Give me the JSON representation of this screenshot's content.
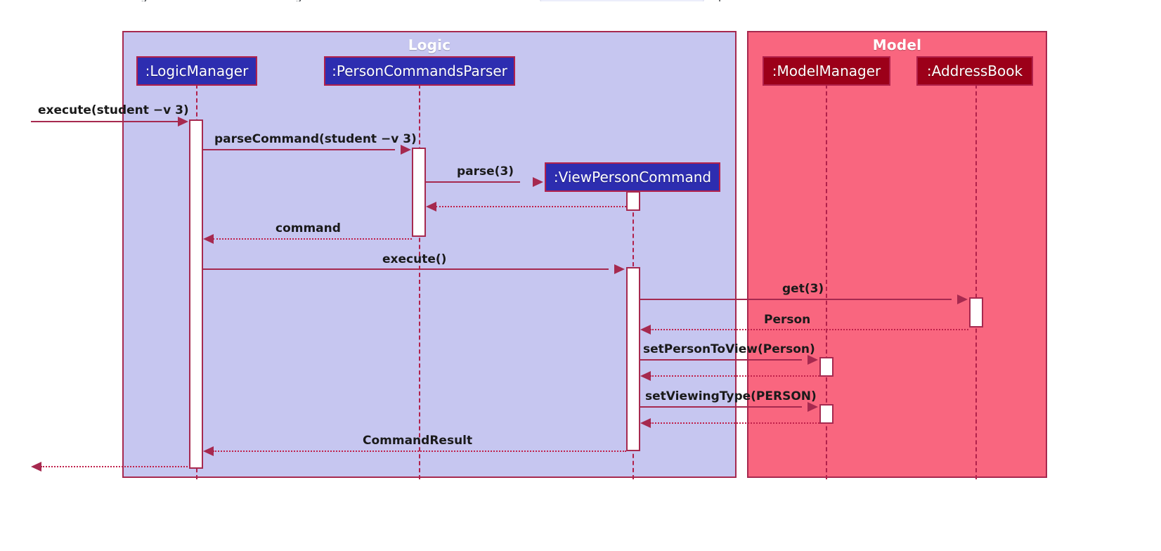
{
  "diagram": {
    "kind": "uml-sequence-diagram",
    "title_top_fragment_1": "g",
    "title_top_fragment_2": "g",
    "title_top_fragment_3": "p",
    "groups": [
      {
        "name": "Logic",
        "label": "Logic",
        "fill": "#c6c6f0",
        "border": "#a6294f"
      },
      {
        "name": "Model",
        "label": "Model",
        "fill": "#f9667f",
        "border": "#a6294f"
      }
    ],
    "participants": [
      {
        "id": "logicmanager",
        "label": ":LogicManager",
        "group": "Logic",
        "fill": "#2d2db0"
      },
      {
        "id": "personcommandsparser",
        "label": ":PersonCommandsParser",
        "group": "Logic",
        "fill": "#2d2db0"
      },
      {
        "id": "viewpersoncommand",
        "label": ":ViewPersonCommand",
        "group": "Logic",
        "fill": "#2d2db0"
      },
      {
        "id": "modelmanager",
        "label": ":ModelManager",
        "group": "Model",
        "fill": "#9c0019"
      },
      {
        "id": "addressbook",
        "label": ":AddressBook",
        "group": "Model",
        "fill": "#9c0019"
      }
    ],
    "messages": [
      {
        "seq": 1,
        "label": "execute(student −v 3)",
        "from": "actor",
        "to": "logicmanager",
        "type": "call",
        "bold": true
      },
      {
        "seq": 2,
        "label": "parseCommand(student −v 3)",
        "from": "logicmanager",
        "to": "personcommandsparser",
        "type": "call",
        "bold": true
      },
      {
        "seq": 3,
        "label": "parse(3)",
        "from": "personcommandsparser",
        "to": "viewpersoncommand",
        "type": "call",
        "bold": true
      },
      {
        "seq": 4,
        "label": "",
        "from": "viewpersoncommand",
        "to": "personcommandsparser",
        "type": "return",
        "bold": false
      },
      {
        "seq": 5,
        "label": "command",
        "from": "personcommandsparser",
        "to": "logicmanager",
        "type": "return",
        "bold": true
      },
      {
        "seq": 6,
        "label": "execute()",
        "from": "logicmanager",
        "to": "viewpersoncommand",
        "type": "call",
        "bold": true
      },
      {
        "seq": 7,
        "label": "get(3)",
        "from": "viewpersoncommand",
        "to": "addressbook",
        "type": "call",
        "bold": true
      },
      {
        "seq": 8,
        "label": "Person",
        "from": "addressbook",
        "to": "viewpersoncommand",
        "type": "return",
        "bold": true
      },
      {
        "seq": 9,
        "label": "setPersonToView(Person)",
        "from": "viewpersoncommand",
        "to": "modelmanager",
        "type": "call",
        "bold": true
      },
      {
        "seq": 10,
        "label": "",
        "from": "modelmanager",
        "to": "viewpersoncommand",
        "type": "return",
        "bold": false
      },
      {
        "seq": 11,
        "label": "setViewingType(PERSON)",
        "from": "viewpersoncommand",
        "to": "modelmanager",
        "type": "call",
        "bold": true
      },
      {
        "seq": 12,
        "label": "",
        "from": "modelmanager",
        "to": "viewpersoncommand",
        "type": "return",
        "bold": false
      },
      {
        "seq": 13,
        "label": "CommandResult",
        "from": "viewpersoncommand",
        "to": "logicmanager",
        "type": "return",
        "bold": true
      },
      {
        "seq": 14,
        "label": "",
        "from": "logicmanager",
        "to": "actor",
        "type": "return",
        "bold": false
      }
    ],
    "colors": {
      "logic_fill": "#c6c6f0",
      "model_fill": "#f9667f",
      "frame_border": "#a6294f",
      "logic_participant": "#2d2db0",
      "model_participant": "#9c0019",
      "arrow": "#a6294f",
      "return_arrow": "#c0204a",
      "activation_fill": "#ffffff",
      "label_text": "#1a1a1a",
      "group_title_text": "#ffffff"
    }
  }
}
